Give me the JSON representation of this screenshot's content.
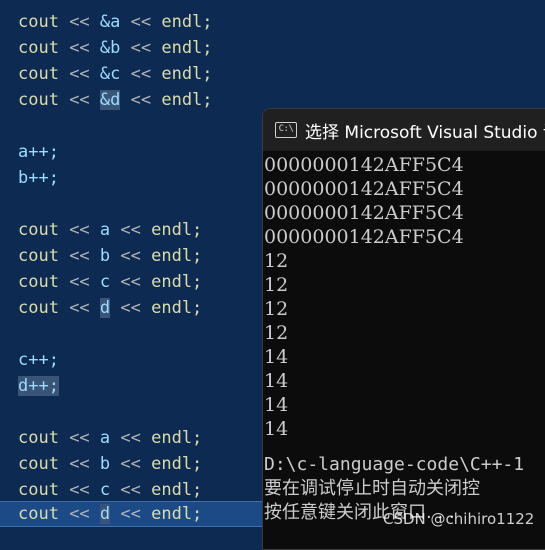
{
  "editor": {
    "lines": [
      {
        "kw": "cout",
        "op1": " << ",
        "var": "&a",
        "op2": " << ",
        "end": "endl;"
      },
      {
        "kw": "cout",
        "op1": " << ",
        "var": "&b",
        "op2": " << ",
        "end": "endl;"
      },
      {
        "kw": "cout",
        "op1": " << ",
        "var": "&c",
        "op2": " << ",
        "end": "endl;"
      },
      {
        "kw": "cout",
        "op1": " << ",
        "var": "&d",
        "op2": " << ",
        "end": "endl;"
      },
      {
        "stmt": "a++;"
      },
      {
        "stmt": "b++;"
      },
      {
        "kw": "cout",
        "op1": " << ",
        "var": "a",
        "op2": " << ",
        "end": "endl;"
      },
      {
        "kw": "cout",
        "op1": " << ",
        "var": "b",
        "op2": " << ",
        "end": "endl;"
      },
      {
        "kw": "cout",
        "op1": " << ",
        "var": "c",
        "op2": " << ",
        "end": "endl;"
      },
      {
        "kw": "cout",
        "op1": " << ",
        "var": "d",
        "op2": " << ",
        "end": "endl;"
      },
      {
        "stmt": "c++;"
      },
      {
        "stmt": "d++;"
      },
      {
        "kw": "cout",
        "op1": " << ",
        "var": "a",
        "op2": " << ",
        "end": "endl;"
      },
      {
        "kw": "cout",
        "op1": " << ",
        "var": "b",
        "op2": " << ",
        "end": "endl;"
      },
      {
        "kw": "cout",
        "op1": " << ",
        "var": "c",
        "op2": " << ",
        "end": "endl;"
      },
      {
        "kw": "cout",
        "op1": " << ",
        "var": "d",
        "op2": " << ",
        "end": "endl;"
      }
    ]
  },
  "console": {
    "icon_text": "C:\\",
    "title": "选择 Microsoft Visual Studio 调",
    "output": [
      "0000000142AFF5C4",
      "0000000142AFF5C4",
      "0000000142AFF5C4",
      "0000000142AFF5C4",
      "12",
      "12",
      "12",
      "12",
      "14",
      "14",
      "14",
      "14"
    ],
    "path_line": "D:\\c-language-code\\C++-1",
    "msg_line1": "要在调试停止时自动关闭控",
    "msg_line2": "按任意键关闭此窗口. . ."
  },
  "watermark": "CSDN @chihiro1122"
}
